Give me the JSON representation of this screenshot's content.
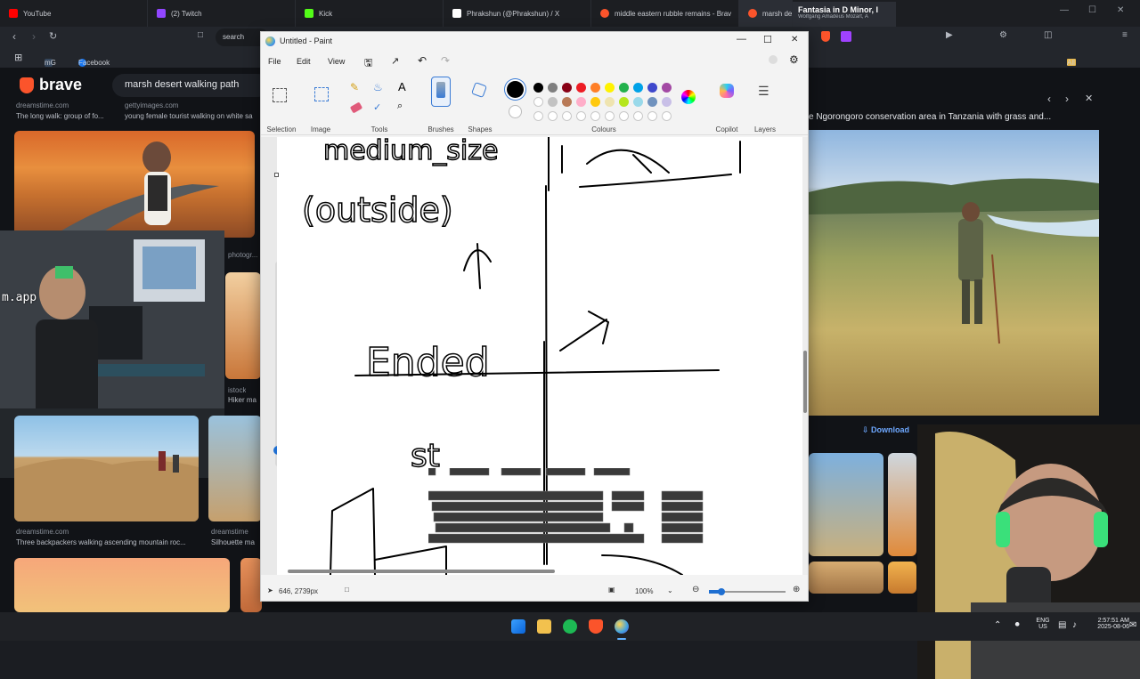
{
  "browser": {
    "tabs": [
      {
        "label": "YouTube",
        "color": "#ff0000"
      },
      {
        "label": "(2) Twitch",
        "color": "#9146ff"
      },
      {
        "label": "Kick",
        "color": "#53fc18"
      },
      {
        "label": "Phrakshun (@Phrakshun) / X",
        "color": "#ffffff"
      },
      {
        "label": "middle eastern rubble remains - Brav",
        "color": "#fb542b"
      },
      {
        "label": "marsh des",
        "color": "#fb542b"
      }
    ],
    "media_popup": {
      "title": "Fantasia in D Minor, I",
      "artist": "Wolfgang Amadeus Mozart, A"
    },
    "address_text": "search",
    "bookmarks": {
      "item1": "mG",
      "item2": "Facebook",
      "all": "All Bookmarks"
    }
  },
  "search": {
    "brand": "brave",
    "query": "marsh desert walking path",
    "results": [
      {
        "source": "dreamstime.com",
        "title": "The long walk: group of fo..."
      },
      {
        "source": "gettyimages.com",
        "title": "young female tourist walking on white sa"
      },
      {
        "source": "istock",
        "title": "Hiker ma"
      },
      {
        "source": "photogr...",
        "title": ""
      },
      {
        "source": "dreamstime.com",
        "title": "Three backpackers walking ascending mountain roc..."
      },
      {
        "source": "dreamstime",
        "title": "Silhouette ma"
      }
    ],
    "watermark": "m.app"
  },
  "preview": {
    "title": "e Ngorongoro conservation area in Tanzania with grass and...",
    "download": "Download"
  },
  "paint": {
    "title": "Untitled - Paint",
    "menu": [
      "File",
      "Edit",
      "View"
    ],
    "groups": [
      "Selection",
      "Image",
      "Tools",
      "Brushes",
      "Shapes",
      "Colours",
      "Copilot",
      "Layers"
    ],
    "colours_row1": [
      "#000000",
      "#7f7f7f",
      "#880015",
      "#ed1c24",
      "#ff7f27",
      "#fff200",
      "#22b14c",
      "#00a2e8",
      "#3f48cc",
      "#a349a4"
    ],
    "colours_row2": [
      "#ffffff",
      "#c3c3c3",
      "#b97a57",
      "#ffaec9",
      "#ffc90e",
      "#efe4b0",
      "#b5e61d",
      "#99d9ea",
      "#7092be",
      "#c8bfe7"
    ],
    "canvas_text": [
      "medium_size",
      "(outside)",
      "Ended",
      "st"
    ],
    "status": {
      "cursor": "646, 2739px",
      "zoom": "100%"
    }
  },
  "taskbar": {
    "lang": "ENG",
    "region": "US",
    "time": "2:57:51 AM",
    "date": "2025-08-06"
  }
}
